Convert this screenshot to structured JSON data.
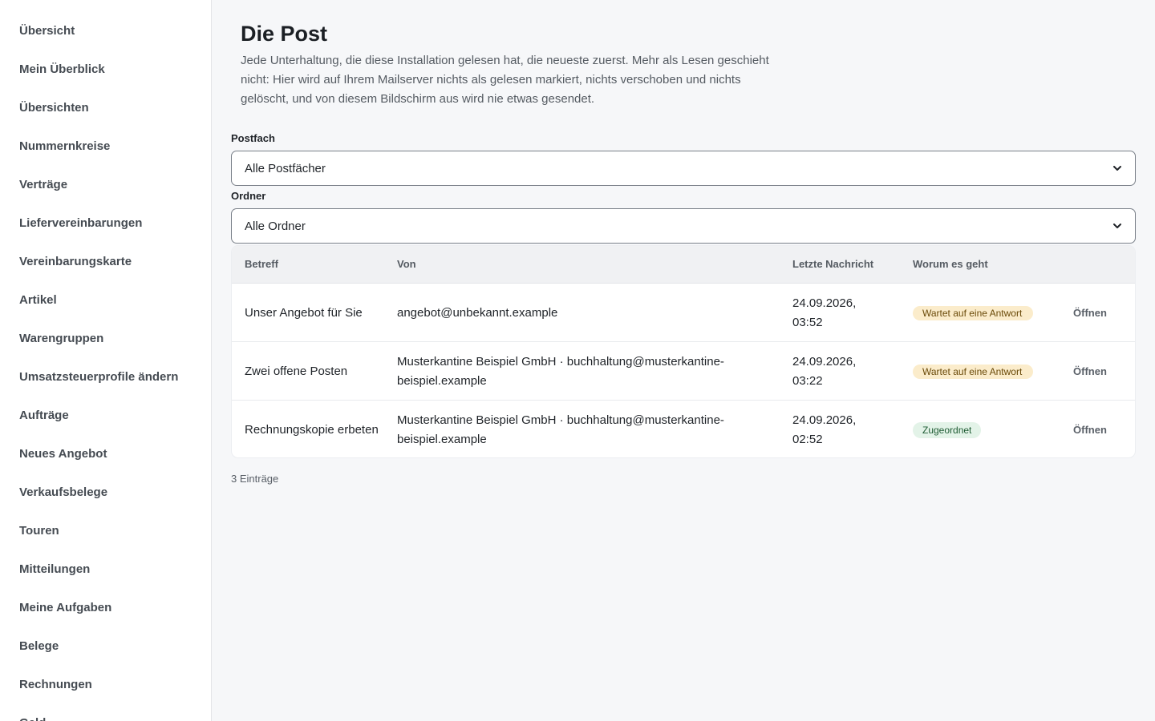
{
  "sidebar": {
    "items": [
      {
        "label": "Übersicht"
      },
      {
        "label": "Mein Überblick"
      },
      {
        "label": "Übersichten"
      },
      {
        "label": "Nummernkreise"
      },
      {
        "label": "Verträge"
      },
      {
        "label": "Liefervereinbarungen"
      },
      {
        "label": "Vereinbarungskarte"
      },
      {
        "label": "Artikel"
      },
      {
        "label": "Warengruppen"
      },
      {
        "label": "Umsatzsteuerprofile ändern"
      },
      {
        "label": "Aufträge"
      },
      {
        "label": "Neues Angebot"
      },
      {
        "label": "Verkaufsbelege"
      },
      {
        "label": "Touren"
      },
      {
        "label": "Mitteilungen"
      },
      {
        "label": "Meine Aufgaben"
      },
      {
        "label": "Belege"
      },
      {
        "label": "Rechnungen"
      },
      {
        "label": "Geld"
      }
    ]
  },
  "header": {
    "title": "Die Post",
    "description": "Jede Unterhaltung, die diese Installation gelesen hat, die neueste zuerst. Mehr als Lesen geschieht nicht: Hier wird auf Ihrem Mailserver nichts als gelesen markiert, nichts verschoben und nichts gelöscht, und von diesem Bildschirm aus wird nie etwas gesendet."
  },
  "filters": {
    "mailbox": {
      "label": "Postfach",
      "value": "Alle Postfächer"
    },
    "folder": {
      "label": "Ordner",
      "value": "Alle Ordner"
    }
  },
  "table": {
    "columns": [
      "Betreff",
      "Von",
      "Letzte Nachricht",
      "Worum es geht",
      ""
    ],
    "rows": [
      {
        "subject": "Unser Angebot für Sie",
        "from": "angebot@unbekannt.example",
        "last": "24.09.2026, 03:52",
        "status": "Wartet auf eine Antwort",
        "status_kind": "wait",
        "action": "Öffnen"
      },
      {
        "subject": "Zwei offene Posten",
        "from": "Musterkantine Beispiel GmbH · buchhaltung@musterkantine-beispiel.example",
        "last": "24.09.2026, 03:22",
        "status": "Wartet auf eine Antwort",
        "status_kind": "wait",
        "action": "Öffnen"
      },
      {
        "subject": "Rechnungskopie erbeten",
        "from": "Musterkantine Beispiel GmbH · buchhaltung@musterkantine-beispiel.example",
        "last": "24.09.2026, 02:52",
        "status": "Zugeordnet",
        "status_kind": "ok",
        "action": "Öffnen"
      }
    ]
  },
  "footer": {
    "count": "3 Einträge"
  },
  "colors": {
    "wait_badge": "#fbeccb",
    "ok_badge": "#e3f3e8",
    "sidebar_bg": "#ffffff",
    "page_bg": "#f6f7f9"
  },
  "icons": {
    "select_arrow": "chevron-down-icon"
  }
}
